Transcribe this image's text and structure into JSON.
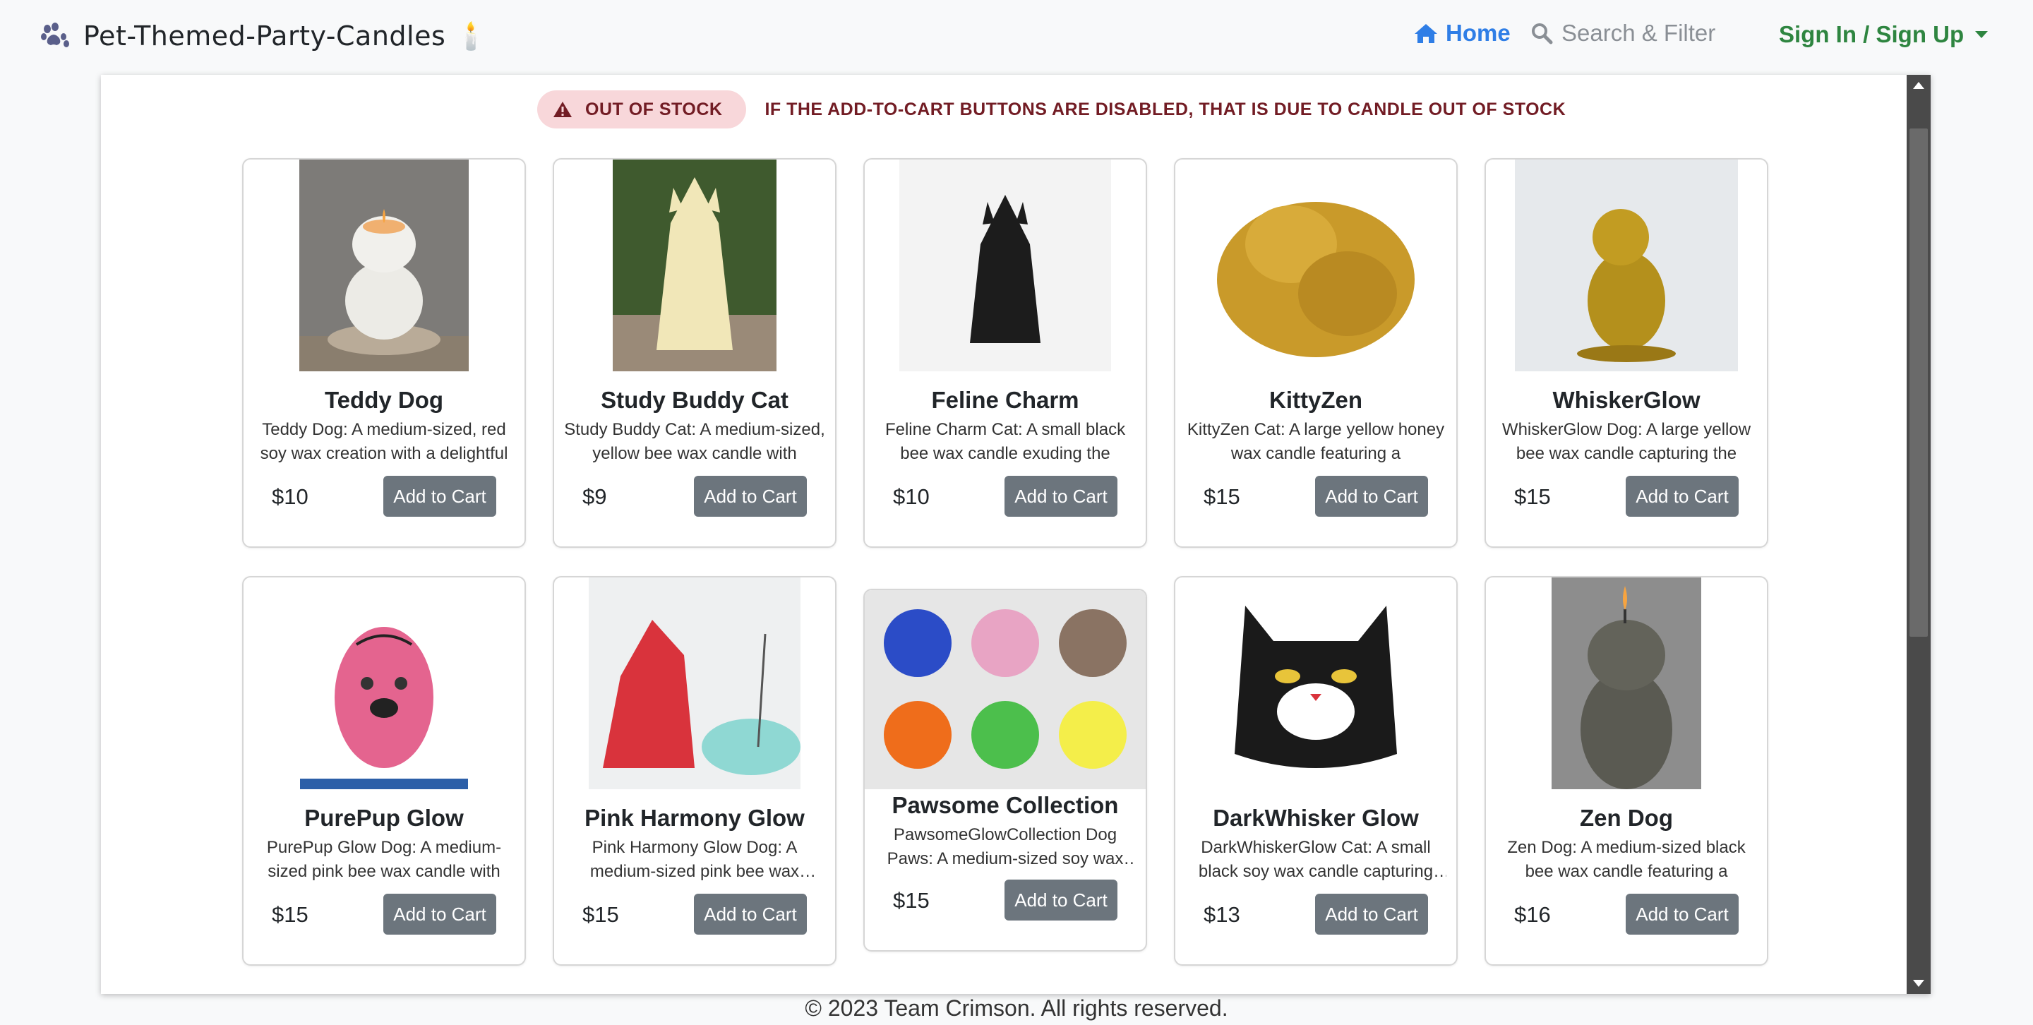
{
  "nav": {
    "brand": "Pet-Themed-Party-Candles 🕯️",
    "brand_icon": "paw-icon",
    "home": "Home",
    "search": "Search & Filter",
    "sign_in": "Sign In / Sign Up"
  },
  "notice": {
    "badge": "OUT OF STOCK",
    "message": "IF THE ADD-TO-CART BUTTONS ARE DISABLED, THAT IS DUE TO CANDLE OUT OF STOCK"
  },
  "add_to_cart_label": "Add to Cart",
  "products": [
    {
      "name": "Teddy Dog",
      "desc": "Teddy Dog: A medium-sized, red soy wax creation with a delightful",
      "price": "$10"
    },
    {
      "name": "Study Buddy Cat",
      "desc": "Study Buddy Cat: A medium-sized, yellow bee wax candle with",
      "price": "$9"
    },
    {
      "name": "Feline Charm",
      "desc": "Feline Charm Cat: A small black bee wax candle exuding the",
      "price": "$10"
    },
    {
      "name": "KittyZen",
      "desc": "KittyZen Cat: A large yellow honey wax candle featuring a",
      "price": "$15"
    },
    {
      "name": "WhiskerGlow",
      "desc": "WhiskerGlow Dog: A large yellow bee wax candle capturing the",
      "price": "$15"
    },
    {
      "name": "PurePup Glow",
      "desc": "PurePup Glow Dog: A medium-sized pink bee wax candle with",
      "price": "$15"
    },
    {
      "name": "Pink Harmony Glow",
      "desc": "Pink Harmony Glow Dog: A medium-sized pink bee wax candle",
      "price": "$15"
    },
    {
      "name": "Pawsome Collection",
      "desc": "PawsomeGlowCollection Dog Paws: A medium-sized soy wax set",
      "price": "$15"
    },
    {
      "name": "DarkWhisker Glow",
      "desc": "DarkWhiskerGlow Cat: A small black soy wax candle capturing the",
      "price": "$13"
    },
    {
      "name": "Zen Dog",
      "desc": "Zen Dog: A medium-sized black bee wax candle featuring a",
      "price": "$16"
    }
  ],
  "footer": "© 2023 Team Crimson. All rights reserved.",
  "colors": {
    "home": "#2f7ee6",
    "sign_in": "#2e8540",
    "button": "#6c757d",
    "alert_bg": "#f8d7da",
    "alert_text": "#721c24"
  }
}
